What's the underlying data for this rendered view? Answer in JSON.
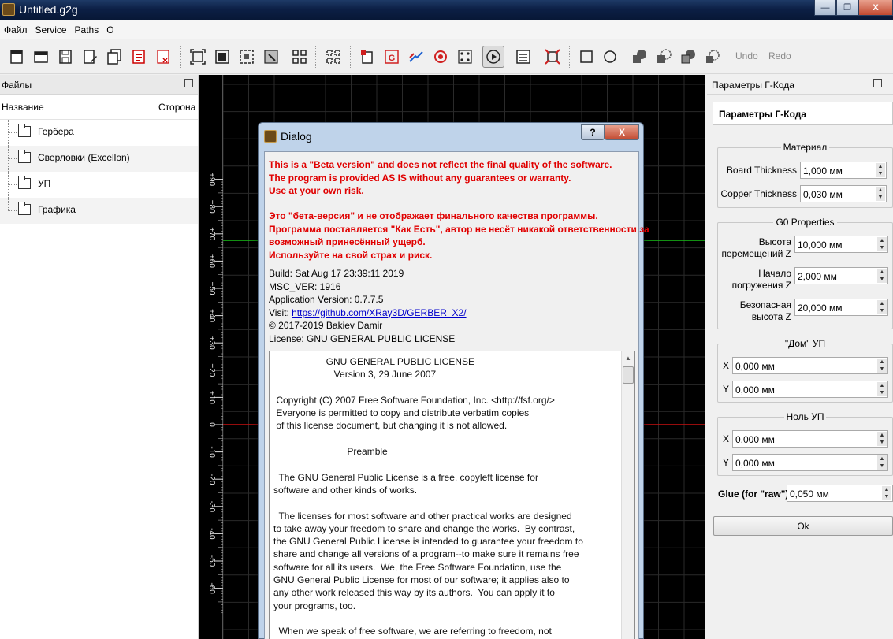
{
  "window": {
    "title": "Untitled.g2g",
    "controls": [
      "—",
      "❐",
      "X"
    ]
  },
  "menu": [
    "Файл",
    "Service",
    "Paths",
    "O"
  ],
  "toolbar": {
    "undo_label": "Undo",
    "redo_label": "Redo",
    "icons": [
      "new-file-icon",
      "open-folder-icon",
      "save-icon",
      "save-as-icon",
      "save-all-icon",
      "export-pdf-icon",
      "close-file-icon",
      "zoom-fit-icon",
      "zoom-to-icon",
      "zoom-selection-icon",
      "zoom-area-icon",
      "select-grid-icon",
      "select-icon",
      "pcb-icon",
      "gerber-icon",
      "path-icon",
      "drill-icon",
      "dots-icon",
      "play-icon",
      "gcode-properties-icon",
      "zero-point-icon",
      "rectangle-icon",
      "circle-icon",
      "shape-union-icon",
      "shape-arc-icon",
      "shape-subtract-icon",
      "shape-settings-icon"
    ]
  },
  "files_panel": {
    "title": "Файлы",
    "col_name": "Название",
    "col_side": "Сторона",
    "items": [
      "Гербера",
      "Сверловки (Excellon)",
      "УП",
      "Графика"
    ]
  },
  "ruler": {
    "ticks": [
      "+90",
      "+80",
      "+70",
      "+60",
      "+50",
      "+40",
      "+30",
      "+20",
      "+10",
      "0",
      "-10",
      "-20",
      "-30",
      "-40",
      "-50",
      "-60"
    ]
  },
  "gcode_panel": {
    "title": "Параметры Г-Кода",
    "header": "Параметры Г-Кода",
    "material": {
      "title": "Материал",
      "board_thickness_label": "Board Thickness",
      "board_thickness_value": "1,000 мм",
      "copper_thickness_label": "Copper Thickness",
      "copper_thickness_value": "0,030 мм"
    },
    "g0": {
      "title": "G0 Properties",
      "height_label": "Высота перемещений Z",
      "height_value": "10,000 мм",
      "plunge_label": "Начало погружения Z",
      "plunge_value": "2,000 мм",
      "safe_label": "Безопасная высота Z",
      "safe_value": "20,000 мм"
    },
    "home": {
      "title": "\"Дом\" УП",
      "x_label": "X",
      "x_value": "0,000 мм",
      "y_label": "Y",
      "y_value": "0,000 мм"
    },
    "zero": {
      "title": "Ноль УП",
      "x_label": "X",
      "x_value": "0,000 мм",
      "y_label": "Y",
      "y_value": "0,000 мм"
    },
    "glue_label": "Glue (for \"raw\")",
    "glue_value": "0,050 мм",
    "ok_label": "Ok"
  },
  "dialog": {
    "title": "Dialog",
    "help_label": "?",
    "close_label": "X",
    "warning_en": [
      "This is a \"Beta version\" and does not reflect the final quality of the software.",
      "The program is provided AS IS without any guarantees or warranty.",
      "Use at your own risk."
    ],
    "warning_ru": [
      "Это \"бета-версия\" и не отображает финального качества программы.",
      "Программа поставляется \"Как Есть\", автор не несёт никакой ответственности за",
      "возможный принесённый ущерб.",
      "Используйте на свой страх и риск."
    ],
    "build": "Build: Sat Aug 17 23:39:11 2019",
    "msc_ver": "MSC_VER: 1916",
    "app_version": "Application Version: 0.7.7.5",
    "visit_prefix": "Visit: ",
    "visit_link": "https://github.com/XRay3D/GERBER_X2/",
    "copyright": "© 2017-2019 Bakiev Damir",
    "license": "License: GNU GENERAL PUBLIC LICENSE",
    "license_text": "                    GNU GENERAL PUBLIC LICENSE\n                       Version 3, 29 June 2007\n\n Copyright (C) 2007 Free Software Foundation, Inc. <http://fsf.org/>\n Everyone is permitted to copy and distribute verbatim copies\n of this license document, but changing it is not allowed.\n\n                            Preamble\n\n  The GNU General Public License is a free, copyleft license for\nsoftware and other kinds of works.\n\n  The licenses for most software and other practical works are designed\nto take away your freedom to share and change the works.  By contrast,\nthe GNU General Public License is intended to guarantee your freedom to\nshare and change all versions of a program--to make sure it remains free\nsoftware for all its users.  We, the Free Software Foundation, use the\nGNU General Public License for most of our software; it applies also to\nany other work released this way by its authors.  You can apply it to\nyour programs, too.\n\n  When we speak of free software, we are referring to freedom, not"
  },
  "colors": {
    "canvas_bg": "#000000",
    "grid": "#2a2a2a",
    "axis_red": "#c81010",
    "axis_green": "#18c018",
    "warning_red": "#e00000"
  }
}
